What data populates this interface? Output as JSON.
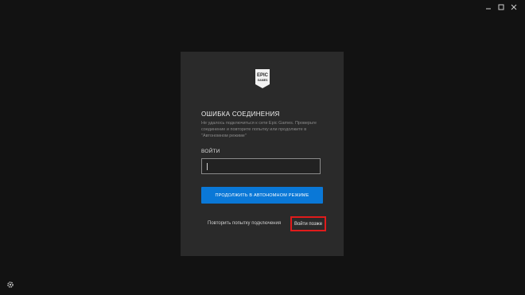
{
  "window": {
    "controls": [
      "minimize-icon",
      "maximize-icon",
      "close-icon"
    ]
  },
  "dialog": {
    "logo_icon": "epic-games-logo",
    "title": "ОШИБКА СОЕДИНЕНИЯ",
    "description": "Не удалось подключиться к сети Epic Games. Проверьте соединение и повторите попытку или продолжите в \"Автономном режиме\"",
    "login_label": "ВОЙТИ",
    "login_value": "",
    "offline_button": "ПРОДОЛЖИТЬ В АВТОНОМНОМ РЕЖИМЕ",
    "retry_link": "Повторить попытку подключения",
    "later_button": "Войти позже"
  },
  "footer": {
    "settings_icon": "gear-icon"
  },
  "colors": {
    "background": "#121212",
    "card": "#2a2a2a",
    "accent": "#0a78d7",
    "highlight": "#e01b1b"
  }
}
